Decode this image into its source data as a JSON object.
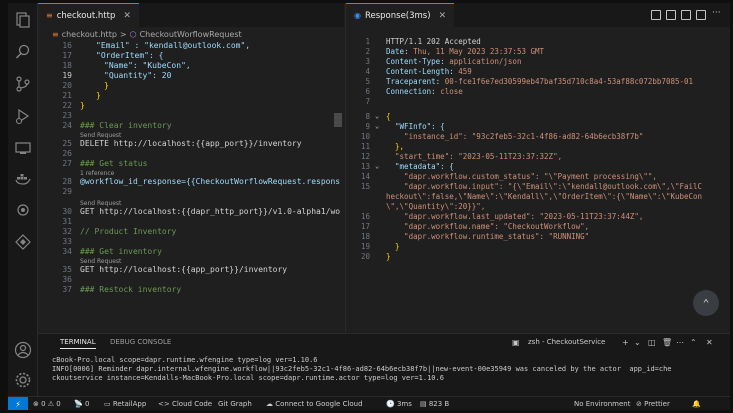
{
  "left_tabs": [
    {
      "label": "checkout.http",
      "icon": "http-file-icon"
    }
  ],
  "breadcrumb": {
    "file": "checkout.http",
    "sep": ">",
    "request": "CheckoutWorflowRequest"
  },
  "left_code": [
    {
      "num": "16",
      "text": "\"Email\" : \"kendall@outlook.com\","
    },
    {
      "num": "17",
      "text": "\"OrderItem\": {"
    },
    {
      "num": "18",
      "text": "\"Name\": \"KubeCon\","
    },
    {
      "num": "19",
      "text": "\"Quantity\": 20"
    },
    {
      "num": "20",
      "text": "}"
    },
    {
      "num": "21",
      "text": "}"
    },
    {
      "num": "22",
      "text": "}"
    },
    {
      "num": "23",
      "text": ""
    },
    {
      "num": "24",
      "text": "### Clear inventory"
    },
    {
      "num": "25",
      "text": "DELETE http://localhost:{{app_port}}/inventory"
    },
    {
      "num": "26",
      "text": ""
    },
    {
      "num": "27",
      "text": "### Get status"
    },
    {
      "num": "28",
      "text": "@workflow_id_response={{CheckoutWorflowRequest.respons"
    },
    {
      "num": "29",
      "text": ""
    },
    {
      "num": "30",
      "text": "GET http://localhost:{{dapr_http_port}}/v1.0-alpha1/wo"
    },
    {
      "num": "31",
      "text": ""
    },
    {
      "num": "32",
      "text": "// Product Inventory"
    },
    {
      "num": "33",
      "text": ""
    },
    {
      "num": "34",
      "text": "### Get inventory"
    },
    {
      "num": "35",
      "text": "GET http://localhost:{{app_port}}/inventory"
    },
    {
      "num": "36",
      "text": ""
    },
    {
      "num": "37",
      "text": "### Restock inventory"
    }
  ],
  "code_hints": {
    "send_request": "Send Request",
    "reference": "1 reference"
  },
  "right_tab": {
    "label": "Response(3ms)"
  },
  "response_lines": [
    {
      "num": "1",
      "text": "HTTP/1.1 202 Accepted"
    },
    {
      "num": "2",
      "key": "Date",
      "value": "Thu, 11 May 2023 23:37:53 GMT"
    },
    {
      "num": "3",
      "key": "Content-Type",
      "value": "application/json"
    },
    {
      "num": "4",
      "key": "Content-Length",
      "value": "459"
    },
    {
      "num": "5",
      "key": "Traceparent",
      "value": "00-fce1f6e7ed30599eb47baf35d710c8a4-53af88c072bb7085-01"
    },
    {
      "num": "6",
      "key": "Connection",
      "value": "close"
    },
    {
      "num": "7",
      "text": ""
    },
    {
      "num": "8",
      "text": "{"
    },
    {
      "num": "9",
      "text": "  \"WFInfo\": {"
    },
    {
      "num": "10",
      "text": "    \"instance_id\": \"93c2feb5-32c1-4f86-ad82-64b6ecb38f7b\""
    },
    {
      "num": "11",
      "text": "  },"
    },
    {
      "num": "12",
      "text": "  \"start_time\": \"2023-05-11T23:37:32Z\","
    },
    {
      "num": "13",
      "text": "  \"metadata\": {"
    },
    {
      "num": "14",
      "text": "    \"dapr.workflow.custom_status\": \"\\\"Payment processing\\\"\","
    },
    {
      "num": "15",
      "text": "    \"dapr.workflow.input\": \"{\\\"Email\\\":\\\"kendall@outlook.com\\\",\\\"FailC"
    },
    {
      "num": "",
      "text": "heckout\\\":false,\\\"Name\\\":\\\"Kendall\\\",\\\"OrderItem\\\":{\\\"Name\\\":\\\"KubeCon"
    },
    {
      "num": "",
      "text": "\\\",\\\"Quantity\\\":20}}\","
    },
    {
      "num": "16",
      "text": "    \"dapr.workflow.last_updated\": \"2023-05-11T23:37:44Z\","
    },
    {
      "num": "17",
      "text": "    \"dapr.workflow.name\": \"CheckoutWorkflow\","
    },
    {
      "num": "18",
      "text": "    \"dapr.workflow.runtime_status\": \"RUNNING\""
    },
    {
      "num": "19",
      "text": "  }"
    },
    {
      "num": "20",
      "text": "}"
    }
  ],
  "panel": {
    "tabs": [
      "TERMINAL",
      "DEBUG CONSOLE"
    ],
    "terminal_name": "zsh - CheckoutService",
    "lines": [
      "cBook-Pro.local scope=dapr.runtime.wfengine type=log ver=1.10.6",
      "INFO[0006] Reminder dapr.internal.wfengine.workflow||93c2feb5-32c1-4f86-ad82-64b6ecb38f7b||new-event-00e35949 was canceled by the actor  app_id=che",
      "ckoutservice instance=Kendalls-MacBook-Pro.local scope=dapr.runtime.actor type=log ver=1.10.6"
    ]
  },
  "status_bar": {
    "problems": "0",
    "warnings": "0",
    "ports": "0",
    "items": [
      "RetailApp",
      "Cloud Code",
      "Git Graph",
      "Connect to Google Cloud",
      "3ms",
      "823 B"
    ],
    "right": [
      "No Environment",
      "Prettier"
    ]
  },
  "colors": {
    "accent": "#0078d4",
    "bg": "#1e1e1e",
    "keyword": "#569cd6",
    "string": "#ce9178",
    "property": "#9cdcfe"
  }
}
